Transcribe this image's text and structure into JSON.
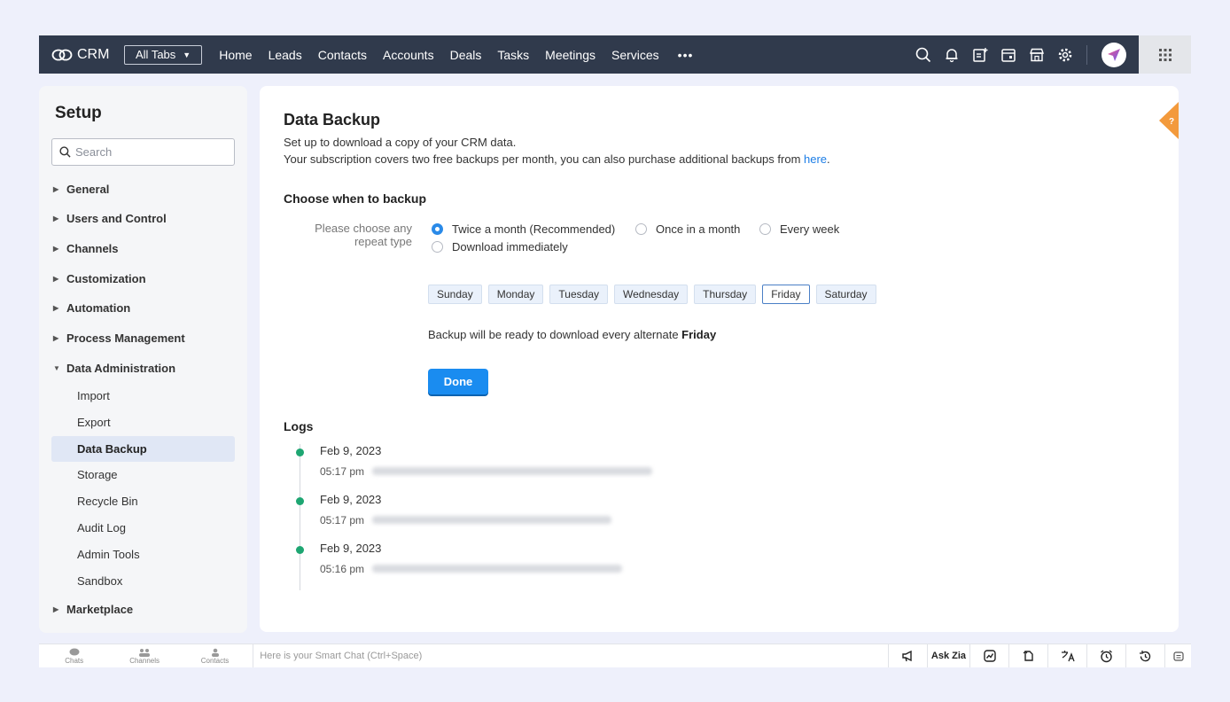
{
  "topbar": {
    "brand": "CRM",
    "all_tabs": "All Tabs",
    "tabs": [
      "Home",
      "Leads",
      "Contacts",
      "Accounts",
      "Deals",
      "Tasks",
      "Meetings",
      "Services"
    ],
    "more": "•••"
  },
  "sidebar": {
    "title": "Setup",
    "search_placeholder": "Search",
    "items": [
      "General",
      "Users and Control",
      "Channels",
      "Customization",
      "Automation",
      "Process Management",
      "Data Administration"
    ],
    "sub_items": [
      "Import",
      "Export",
      "Data Backup",
      "Storage",
      "Recycle Bin",
      "Audit Log",
      "Admin Tools",
      "Sandbox"
    ],
    "last_item": "Marketplace",
    "active_sub_item": "Data Backup"
  },
  "main": {
    "title": "Data Backup",
    "desc1": "Set up to download a copy of your CRM data.",
    "desc2": "Your subscription covers two free backups per month, you can also purchase additional backups from ",
    "desc2_link": "here",
    "desc2_end": ".",
    "section_title": "Choose when to backup",
    "choose_label": "Please choose any repeat type",
    "options": [
      "Twice a month (Recommended)",
      "Once in a month",
      "Every week",
      "Download immediately"
    ],
    "selected_option": "Twice a month (Recommended)",
    "days": [
      "Sunday",
      "Monday",
      "Tuesday",
      "Wednesday",
      "Thursday",
      "Friday",
      "Saturday"
    ],
    "selected_day": "Friday",
    "info_text": "Backup will be ready to download every alternate ",
    "info_day": "Friday",
    "done_label": "Done",
    "logs_title": "Logs",
    "logs": [
      {
        "date": "Feb 9, 2023",
        "time": "05:17 pm"
      },
      {
        "date": "Feb 9, 2023",
        "time": "05:17 pm"
      },
      {
        "date": "Feb 9, 2023",
        "time": "05:16 pm"
      }
    ]
  },
  "bottombar": {
    "tabs": [
      "Chats",
      "Channels",
      "Contacts"
    ],
    "chat_placeholder": "Here is your Smart Chat (Ctrl+Space)",
    "ask_zia": "Ask Zia"
  },
  "colors": {
    "topbar": "#303a4c",
    "accent": "#1a8cf0",
    "timeline_dot": "#1ea672",
    "help_tab": "#f39a3c"
  }
}
